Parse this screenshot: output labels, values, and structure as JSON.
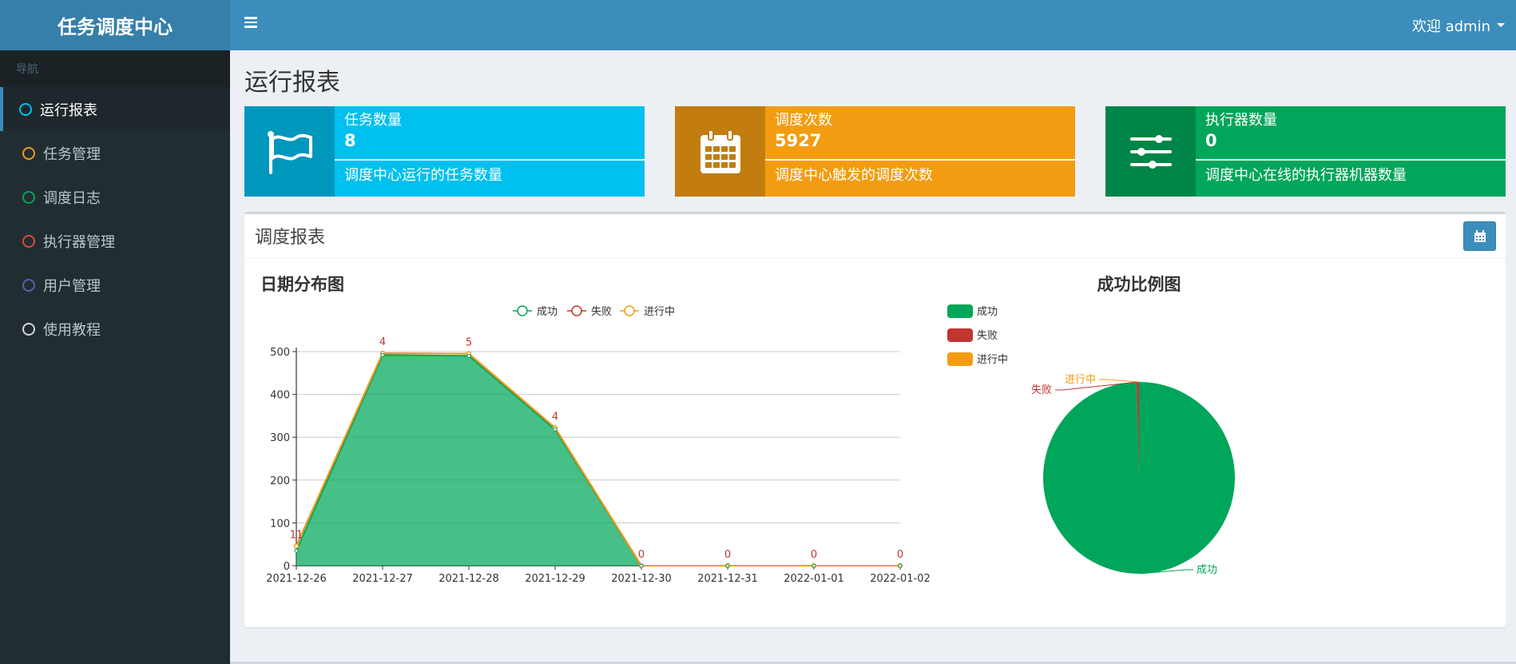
{
  "sidebar": {
    "logo": "任务调度中心",
    "nav_header": "导航",
    "items": [
      {
        "label": "运行报表",
        "color": "#00c0ef"
      },
      {
        "label": "任务管理",
        "color": "#f39c12"
      },
      {
        "label": "调度日志",
        "color": "#00a65a"
      },
      {
        "label": "执行器管理",
        "color": "#dd4b39"
      },
      {
        "label": "用户管理",
        "color": "#605ca8"
      },
      {
        "label": "使用教程",
        "color": "#d2d6de"
      }
    ]
  },
  "header": {
    "user_label": "欢迎 admin"
  },
  "page": {
    "title": "运行报表"
  },
  "info_boxes": [
    {
      "text": "任务数量",
      "number": "8",
      "desc": "调度中心运行的任务数量",
      "color": "#00c0ef",
      "icon_bg": "#0097bc",
      "icon": "flag-icon"
    },
    {
      "text": "调度次数",
      "number": "5927",
      "desc": "调度中心触发的调度次数",
      "color": "#f39c12",
      "icon_bg": "#c27d0e",
      "icon": "calendar-icon"
    },
    {
      "text": "执行器数量",
      "number": "0",
      "desc": "调度中心在线的执行器机器数量",
      "color": "#00a65a",
      "icon_bg": "#008548",
      "icon": "sliders-icon"
    }
  ],
  "panel": {
    "title": "调度报表"
  },
  "chart_data": [
    {
      "type": "area",
      "title": "日期分布图",
      "categories": [
        "2021-12-26",
        "2021-12-27",
        "2021-12-28",
        "2021-12-29",
        "2021-12-30",
        "2021-12-31",
        "2022-01-01",
        "2022-01-02"
      ],
      "ylim": [
        0,
        500
      ],
      "yticks": [
        0,
        100,
        200,
        300,
        400,
        500
      ],
      "legend": [
        "成功",
        "失败",
        "进行中"
      ],
      "legend_placement": "top",
      "grid": true,
      "series": [
        {
          "name": "成功",
          "color": "#00a65a",
          "values": [
            35,
            492,
            490,
            318,
            0,
            0,
            0,
            0
          ]
        },
        {
          "name": "失败",
          "color": "#c23531",
          "values": [
            11,
            4,
            5,
            4,
            0,
            0,
            0,
            0
          ]
        },
        {
          "name": "进行中",
          "color": "#f39c12",
          "values": [
            0,
            0,
            0,
            0,
            0,
            0,
            0,
            0
          ]
        }
      ],
      "data_labels": [
        "11",
        "4",
        "5",
        "4",
        "0",
        "0",
        "0",
        "0"
      ]
    },
    {
      "type": "pie",
      "title": "成功比例图",
      "legend": [
        "成功",
        "失败",
        "进行中"
      ],
      "legend_placement": "left",
      "slices": [
        {
          "name": "成功",
          "value": 5903,
          "color": "#00a65a"
        },
        {
          "name": "失败",
          "value": 24,
          "color": "#c23531"
        },
        {
          "name": "进行中",
          "value": 0,
          "color": "#f39c12"
        }
      ]
    }
  ]
}
